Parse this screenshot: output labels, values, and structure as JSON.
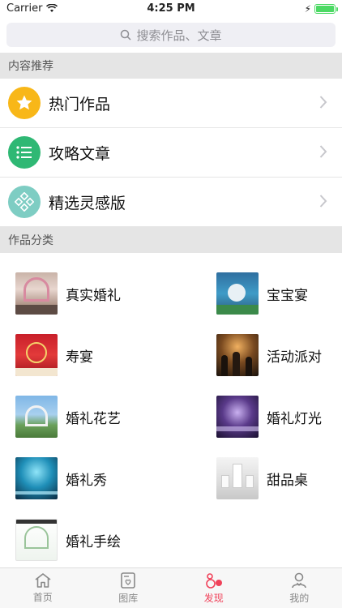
{
  "status": {
    "carrier": "Carrier",
    "time": "4:25 PM"
  },
  "search": {
    "placeholder": "搜索作品、文章"
  },
  "sections": {
    "recommend": "内容推荐",
    "category": "作品分类"
  },
  "recommend_items": [
    {
      "label": "热门作品",
      "icon": "star-icon",
      "color": "#f8b718"
    },
    {
      "label": "攻略文章",
      "icon": "list-icon",
      "color": "#2fb874"
    },
    {
      "label": "精选灵感版",
      "icon": "inspiration-icon",
      "color": "#7ecdc3"
    }
  ],
  "categories": [
    {
      "label": "真实婚礼",
      "thumb": "real-wedding-photo"
    },
    {
      "label": "宝宝宴",
      "thumb": "baby-party-photo"
    },
    {
      "label": "寿宴",
      "thumb": "birthday-banquet-photo"
    },
    {
      "label": "活动派对",
      "thumb": "party-event-photo"
    },
    {
      "label": "婚礼花艺",
      "thumb": "wedding-flowers-photo"
    },
    {
      "label": "婚礼灯光",
      "thumb": "wedding-lighting-photo"
    },
    {
      "label": "婚礼秀",
      "thumb": "wedding-show-photo"
    },
    {
      "label": "甜品桌",
      "thumb": "dessert-table-photo"
    },
    {
      "label": "婚礼手绘",
      "thumb": "wedding-sketch-photo"
    }
  ],
  "tabs": [
    {
      "label": "首页",
      "icon": "home-icon",
      "active": false
    },
    {
      "label": "图库",
      "icon": "gallery-icon",
      "active": false
    },
    {
      "label": "发现",
      "icon": "discover-icon",
      "active": true
    },
    {
      "label": "我的",
      "icon": "profile-icon",
      "active": false
    }
  ],
  "colors": {
    "accent": "#f0425a",
    "section_bg": "#e5e5e5"
  }
}
